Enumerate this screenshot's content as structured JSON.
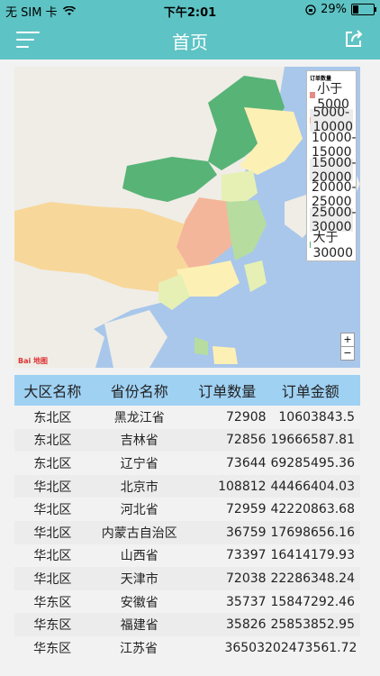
{
  "status_bar": {
    "carrier": "无 SIM 卡",
    "time": "下午2:01",
    "battery": "29%",
    "battery_level": 0.29
  },
  "nav": {
    "title": "首页"
  },
  "map": {
    "legend_title": "订单数量",
    "legend_items": [
      {
        "label": "小于5000",
        "color": "#e38b85"
      },
      {
        "label": "5000-10000",
        "color": "#f4b69b"
      },
      {
        "label": "10000-15000",
        "color": "#f8d79a"
      },
      {
        "label": "15000-20000",
        "color": "#fdf0b5"
      },
      {
        "label": "20000-25000",
        "color": "#e6f0b5"
      },
      {
        "label": "25000-30000",
        "color": "#b6dd9f"
      },
      {
        "label": "大于30000",
        "color": "#58b377"
      }
    ],
    "zoom_in": "+",
    "zoom_out": "−",
    "attribution": "Bai 地图"
  },
  "table": {
    "headers": [
      "大区名称",
      "省份名称",
      "订单数量",
      "订单金额"
    ],
    "rows": [
      [
        "东北区",
        "黑龙江省",
        "72908",
        "10603843.5"
      ],
      [
        "东北区",
        "吉林省",
        "72856",
        "19666587.81"
      ],
      [
        "东北区",
        "辽宁省",
        "73644",
        "69285495.36"
      ],
      [
        "华北区",
        "北京市",
        "108812",
        "44466404.03"
      ],
      [
        "华北区",
        "河北省",
        "72959",
        "42220863.68"
      ],
      [
        "华北区",
        "内蒙古自治区",
        "36759",
        "17698656.16"
      ],
      [
        "华北区",
        "山西省",
        "73397",
        "16414179.93"
      ],
      [
        "华北区",
        "天津市",
        "72038",
        "22286348.24"
      ],
      [
        "华东区",
        "安徽省",
        "35737",
        "15847292.46"
      ],
      [
        "华东区",
        "福建省",
        "35826",
        "25853852.95"
      ],
      [
        "华东区",
        "江苏省",
        "36503",
        "202473561.72"
      ]
    ]
  }
}
